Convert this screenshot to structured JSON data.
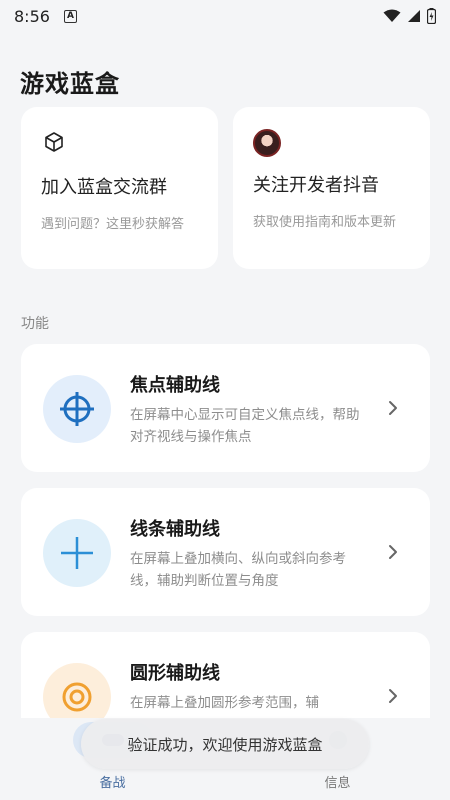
{
  "status_bar": {
    "time": "8:56",
    "notification_glyph": "A"
  },
  "page": {
    "title": "游戏蓝盒"
  },
  "top_cards": [
    {
      "title": "加入蓝盒交流群",
      "desc": "遇到问题？这里秒获解答",
      "icon": "cube-icon"
    },
    {
      "title": "关注开发者抖音",
      "desc": "获取使用指南和版本更新",
      "icon": "avatar"
    }
  ],
  "section": {
    "label": "功能"
  },
  "features": [
    {
      "title": "焦点辅助线",
      "desc": "在屏幕中心显示可自定义焦点线，帮助对齐视线与操作焦点",
      "icon": "crosshair-icon",
      "icon_color": "#1f6fbf",
      "bg": "#e3eefb"
    },
    {
      "title": "线条辅助线",
      "desc": "在屏幕上叠加横向、纵向或斜向参考线，辅助判断位置与角度",
      "icon": "cross-line-icon",
      "icon_color": "#2b8fd6",
      "bg": "#e0f0fa"
    },
    {
      "title": "圆形辅助线",
      "desc": "在屏幕上叠加圆形参考范围，辅",
      "icon": "circle-target-icon",
      "icon_color": "#f0a030",
      "bg": "#fdeedb"
    }
  ],
  "bottom_nav": [
    {
      "label": "备战",
      "active": true
    },
    {
      "label": "信息",
      "active": false
    }
  ],
  "toast": {
    "text": "验证成功，欢迎使用游戏蓝盒"
  },
  "colors": {
    "background": "#f4f5f7",
    "card": "#ffffff",
    "accent": "#4a6fa1"
  }
}
